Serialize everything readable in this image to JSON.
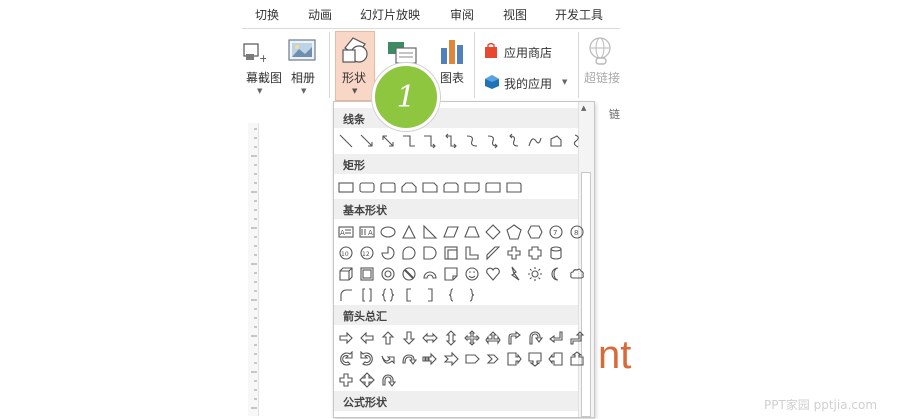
{
  "tabs": [
    "切换",
    "动画",
    "幻灯片放映",
    "审阅",
    "视图",
    "开发工具"
  ],
  "ribbon": {
    "screenshot_label": "幕截图",
    "album_label": "相册",
    "shapes_label": "形状",
    "chart_label": "图表",
    "store_label": "应用商店",
    "myapps_label": "我的应用",
    "hyperlink_label": "超链接",
    "group_cut_label": "链"
  },
  "shapes_panel": {
    "sections": [
      "线条",
      "矩形",
      "基本形状",
      "箭头总汇",
      "公式形状"
    ]
  },
  "step_badge": "1",
  "slide_text_fragment": "nt",
  "watermark": "PPT家园 pptjia.com",
  "colors": {
    "accent_green": "#8ec63f",
    "shapes_button_bg": "#f9d7c6",
    "store_icon": "#e8482f",
    "myapps_icon": "#1e73b9"
  }
}
